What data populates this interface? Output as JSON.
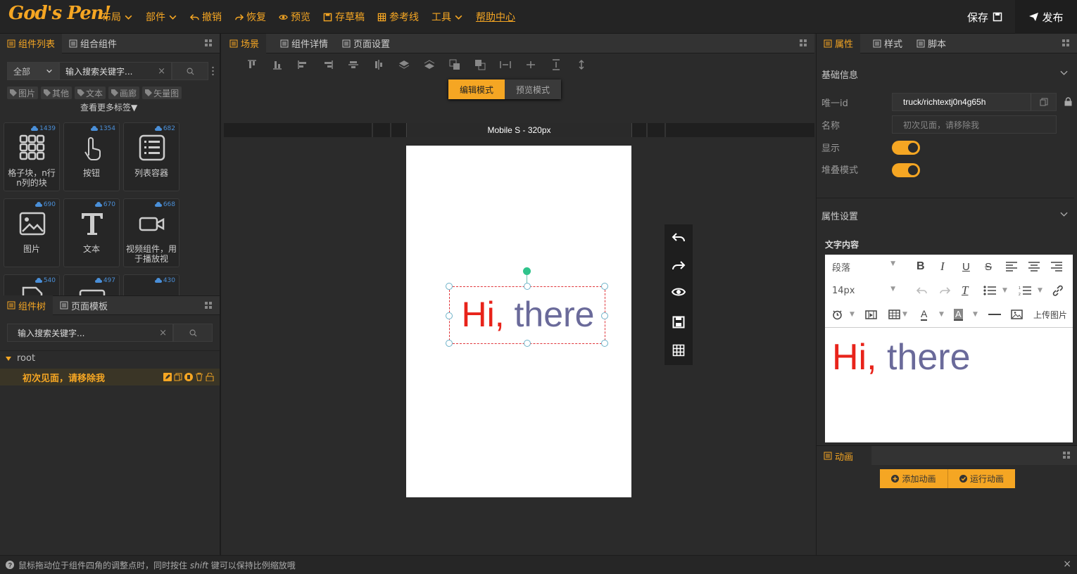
{
  "header": {
    "logo": "God's Pen!",
    "menu": [
      {
        "label": "布局",
        "icon": "chevron-down-icon"
      },
      {
        "label": "部件",
        "icon": "chevron-down-icon"
      },
      {
        "label": "撤销",
        "icon": "undo-icon"
      },
      {
        "label": "恢复",
        "icon": "redo-icon"
      },
      {
        "label": "预览",
        "icon": "eye-icon"
      },
      {
        "label": "存草稿",
        "icon": "floppy-icon"
      },
      {
        "label": "参考线",
        "icon": "grid-icon"
      },
      {
        "label": "工具",
        "icon": "chevron-down-icon"
      },
      {
        "label": "帮助中心",
        "icon": ""
      }
    ],
    "save_label": "保存",
    "publish_label": "发布"
  },
  "components_panel": {
    "tabs": [
      "组件列表",
      "组合组件"
    ],
    "filter_value": "全部",
    "search_placeholder": "输入搜索关键字...",
    "tags": [
      "图片",
      "其他",
      "文本",
      "画廊",
      "矢量图"
    ],
    "more_tags": "查看更多标签▼",
    "cards": [
      {
        "label": "格子块，n行n列的块",
        "count": "1439",
        "icon": "grid-blocks-icon"
      },
      {
        "label": "按钮",
        "count": "1354",
        "icon": "hand-pointer-icon"
      },
      {
        "label": "列表容器",
        "count": "682",
        "icon": "list-icon"
      },
      {
        "label": "图片",
        "count": "690",
        "icon": "image-icon"
      },
      {
        "label": "文本",
        "count": "670",
        "icon": "text-t-icon"
      },
      {
        "label": "视频组件，用于播放视",
        "count": "668",
        "icon": "video-icon"
      },
      {
        "label": "",
        "count": "540",
        "icon": "file-icon"
      },
      {
        "label": "",
        "count": "497",
        "icon": "box-icon"
      },
      {
        "label": "",
        "count": "430",
        "icon": "box-icon"
      }
    ]
  },
  "tree_panel": {
    "tabs": [
      "组件树",
      "页面模板"
    ],
    "search_placeholder": "输入搜索关键字...",
    "root_label": "root",
    "node_label": "初次见面，请移除我"
  },
  "canvas": {
    "tabs": [
      "场景",
      "组件详情",
      "页面设置"
    ],
    "mode_edit": "编辑模式",
    "mode_preview": "预览模式",
    "device_label": "Mobile S - 320px",
    "text_red": "Hi,",
    "text_purple": "there",
    "colors": {
      "red": "#e8231a",
      "purple": "#6a6a9a",
      "accent": "#f5a623"
    }
  },
  "props_panel": {
    "tabs": [
      "属性",
      "样式",
      "脚本"
    ],
    "section_basic": "基础信息",
    "id_label": "唯一id",
    "id_value": "truck/richtextj0n4g65h",
    "name_label": "名称",
    "name_placeholder": "初次见面，请移除我",
    "visible_label": "显示",
    "stack_label": "堆叠模式",
    "section_attr": "属性设置",
    "text_content_label": "文字内容",
    "editor": {
      "block_format": "段落",
      "font_size": "14px",
      "upload_image": "上传图片",
      "content_red": "Hi,",
      "content_purple": "there"
    }
  },
  "anim_panel": {
    "tab": "动画",
    "add_label": "添加动画",
    "run_label": "运行动画"
  },
  "status": {
    "prefix": "鼠标拖动位于组件四角的调整点时，同时按住",
    "key": "shift",
    "suffix": "键可以保持比例缩放哦"
  }
}
